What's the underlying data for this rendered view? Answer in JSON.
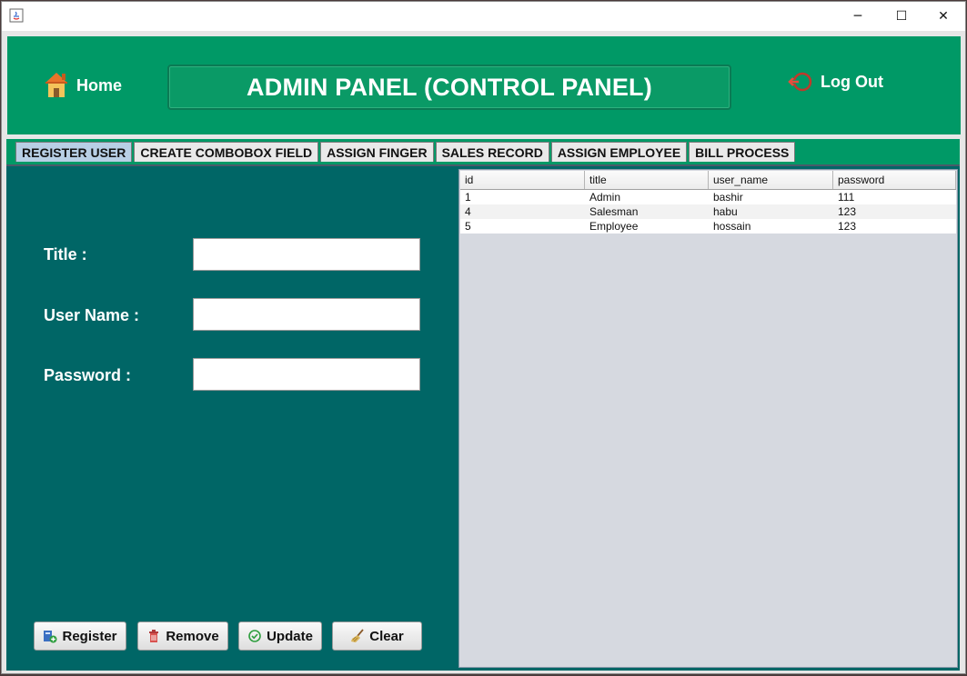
{
  "window": {
    "controls": {
      "minimize": "─",
      "maximize": "☐",
      "close": "✕"
    }
  },
  "header": {
    "home_label": "Home",
    "title": "ADMIN PANEL (CONTROL PANEL)",
    "logout_label": "Log Out"
  },
  "tabs": [
    {
      "label": "REGISTER USER",
      "active": true
    },
    {
      "label": "CREATE COMBOBOX FIELD",
      "active": false
    },
    {
      "label": "ASSIGN FINGER",
      "active": false
    },
    {
      "label": "SALES RECORD",
      "active": false
    },
    {
      "label": "ASSIGN EMPLOYEE",
      "active": false
    },
    {
      "label": "BILL PROCESS",
      "active": false
    }
  ],
  "form": {
    "title_label": "Title :",
    "title_value": "",
    "username_label": "User Name :",
    "username_value": "",
    "password_label": "Password :",
    "password_value": ""
  },
  "buttons": {
    "register": "Register",
    "remove": "Remove",
    "update": "Update",
    "clear": "Clear"
  },
  "table": {
    "columns": [
      "id",
      "title",
      "user_name",
      "password"
    ],
    "rows": [
      [
        "1",
        "Admin",
        "bashir",
        "111"
      ],
      [
        "4",
        "Salesman",
        "habu",
        "123"
      ],
      [
        "5",
        "Employee",
        "hossain",
        "123"
      ]
    ]
  },
  "colors": {
    "header_green": "#009966",
    "main_teal": "#006666",
    "active_tab": "#b8cfe5"
  }
}
